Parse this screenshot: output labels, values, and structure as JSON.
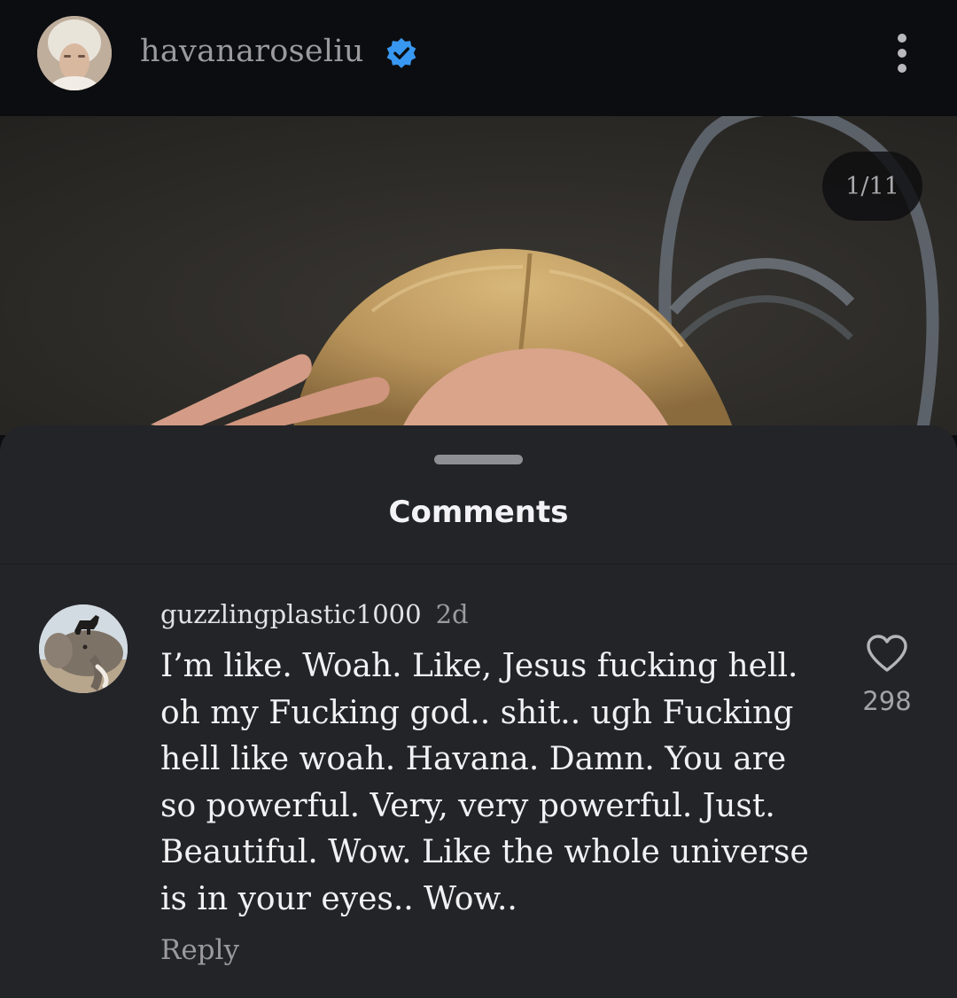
{
  "header": {
    "username": "havanaroseliu",
    "verified_icon": "verified-badge-icon",
    "avatar_icon": "profile-avatar",
    "more_icon": "more-vertical-icon"
  },
  "post": {
    "image_counter": "1/11"
  },
  "comments_sheet": {
    "title": "Comments",
    "comments": [
      {
        "username": "guzzlingplastic1000",
        "time": "2d",
        "text": "I’m like. Woah. Like, Jesus fucking hell.\noh my Fucking god.. shit.. ugh Fucking\nhell like woah. Havana. Damn. You are\nso powerful. Very, very powerful. Just.\nBeautiful. Wow. Like the whole universe\nis in your eyes.. Wow..",
        "reply_label": "Reply",
        "like_count": "298",
        "like_icon": "heart-outline-icon"
      }
    ]
  },
  "colors": {
    "background": "#0c0d10",
    "sheet": "#232428",
    "verified_blue": "#3897f0",
    "text_primary": "#f1f1f3",
    "text_secondary": "#9a9a9f"
  }
}
